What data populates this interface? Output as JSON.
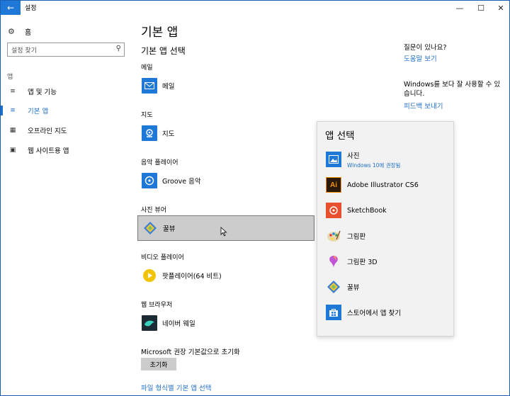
{
  "window": {
    "title": "설정"
  },
  "sidebar": {
    "home": "홈",
    "search_placeholder": "설정 찾기",
    "section": "앱",
    "items": [
      {
        "label": "앱 및 기능",
        "icon": "list-icon"
      },
      {
        "label": "기본 앱",
        "icon": "default-apps-icon",
        "active": true
      },
      {
        "label": "오프라인 지도",
        "icon": "map-icon"
      },
      {
        "label": "웹 사이트용 앱",
        "icon": "web-app-icon"
      }
    ]
  },
  "main": {
    "title": "기본 앱",
    "subtitle": "기본 앱 선택",
    "categories": [
      {
        "label": "메일",
        "app": "메일",
        "icon": "mail-icon"
      },
      {
        "label": "지도",
        "app": "지도",
        "icon": "maps-icon"
      },
      {
        "label": "음악 플레이어",
        "app": "Groove 음악",
        "icon": "groove-icon"
      },
      {
        "label": "사진 뷰어",
        "app": "꿀뷰",
        "icon": "honeyview-icon"
      },
      {
        "label": "비디오 플레이어",
        "app": "팟플레이어(64 비트)",
        "icon": "potplayer-icon"
      },
      {
        "label": "웹 브라우저",
        "app": "네이버 웨일",
        "icon": "whale-icon"
      }
    ],
    "reset_label": "Microsoft 권장 기본값으로 초기화",
    "reset_button": "초기화",
    "file_type_link": "파일 형식별 기본 앱 선택"
  },
  "help": {
    "question": "질문이 있나요?",
    "help_link": "도움말 보기",
    "feedback_text": "Windows를 보다 잘 사용할 수 있습니다.",
    "feedback_link": "피드백 보내기"
  },
  "flyout": {
    "title": "앱 선택",
    "items": [
      {
        "name": "사진",
        "sub": "Windows 10에 권장됨",
        "icon": "photos-icon"
      },
      {
        "name": "Adobe Illustrator CS6",
        "sub": "",
        "icon": "illustrator-icon"
      },
      {
        "name": "SketchBook",
        "sub": "",
        "icon": "sketchbook-icon"
      },
      {
        "name": "그림판",
        "sub": "",
        "icon": "paint-icon"
      },
      {
        "name": "그림판 3D",
        "sub": "",
        "icon": "paint3d-icon"
      },
      {
        "name": "꿀뷰",
        "sub": "",
        "icon": "honeyview-icon"
      },
      {
        "name": "스토어에서 앱 찾기",
        "sub": "",
        "icon": "store-icon"
      }
    ]
  },
  "colors": {
    "accent": "#1e6fc9",
    "titlebar_back": "#1e78d7"
  }
}
